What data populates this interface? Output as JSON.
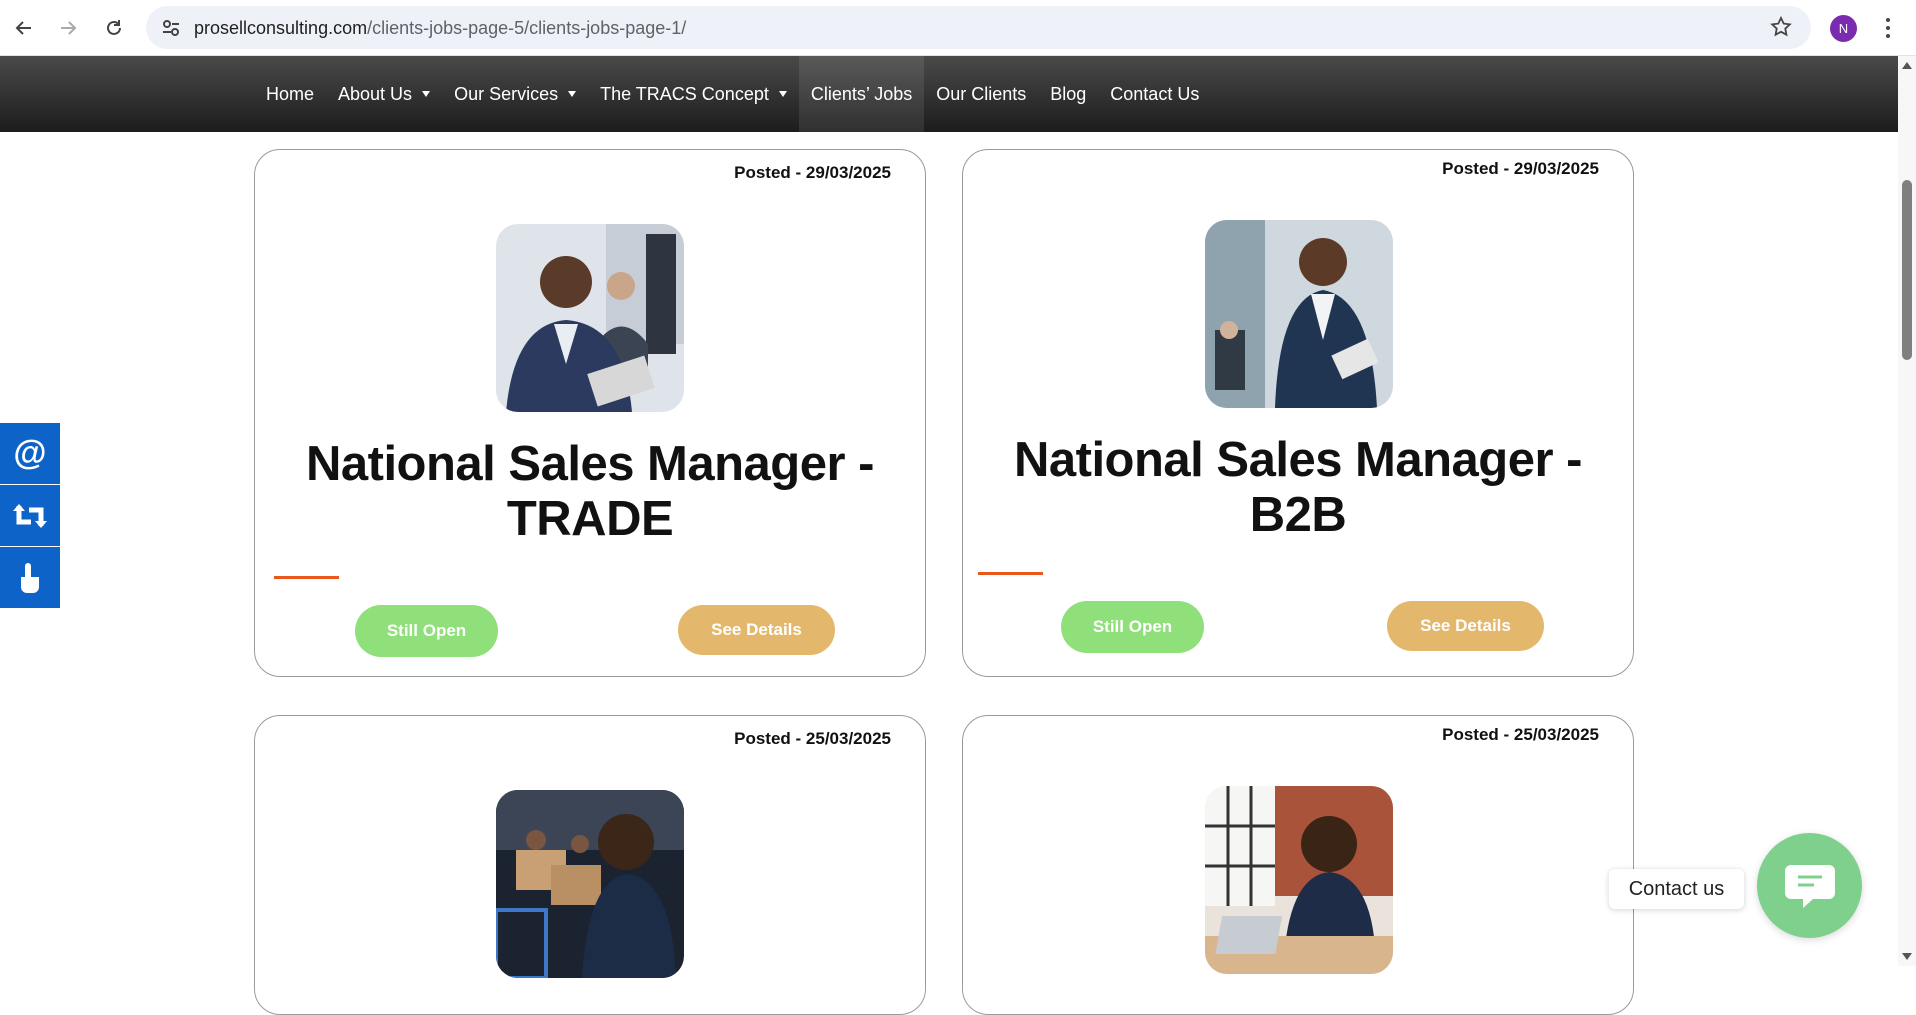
{
  "browser": {
    "url_host": "prosellconsulting.com",
    "url_path": "/clients-jobs-page-5/clients-jobs-page-1/",
    "profile_initial": "N"
  },
  "nav": {
    "items": [
      {
        "label": "Home",
        "dropdown": false,
        "active": false
      },
      {
        "label": "About Us",
        "dropdown": true,
        "active": false
      },
      {
        "label": "Our Services",
        "dropdown": true,
        "active": false
      },
      {
        "label": "The TRACS Concept",
        "dropdown": true,
        "active": false
      },
      {
        "label": "Clients’ Jobs",
        "dropdown": false,
        "active": true
      },
      {
        "label": "Our Clients",
        "dropdown": false,
        "active": false
      },
      {
        "label": "Blog",
        "dropdown": false,
        "active": false
      },
      {
        "label": "Contact Us",
        "dropdown": false,
        "active": false
      }
    ]
  },
  "jobs": [
    {
      "posted": "Posted - 29/03/2025",
      "title_line1": "National Sales Manager -",
      "title_line2": "TRADE",
      "status": "Still Open",
      "details": "See Details"
    },
    {
      "posted": "Posted - 29/03/2025",
      "title_line1": "National Sales Manager -",
      "title_line2": "B2B",
      "status": "Still Open",
      "details": "See Details"
    },
    {
      "posted": "Posted - 25/03/2025"
    },
    {
      "posted": "Posted - 25/03/2025"
    }
  ],
  "contact_widget": {
    "label": "Contact us"
  },
  "colors": {
    "open_button": "#8fe07a",
    "details_button": "#e4b86c",
    "accent_rule": "#e8581e",
    "side_buttons": "#0e63c8",
    "contact_bubble": "#7fd08d"
  }
}
